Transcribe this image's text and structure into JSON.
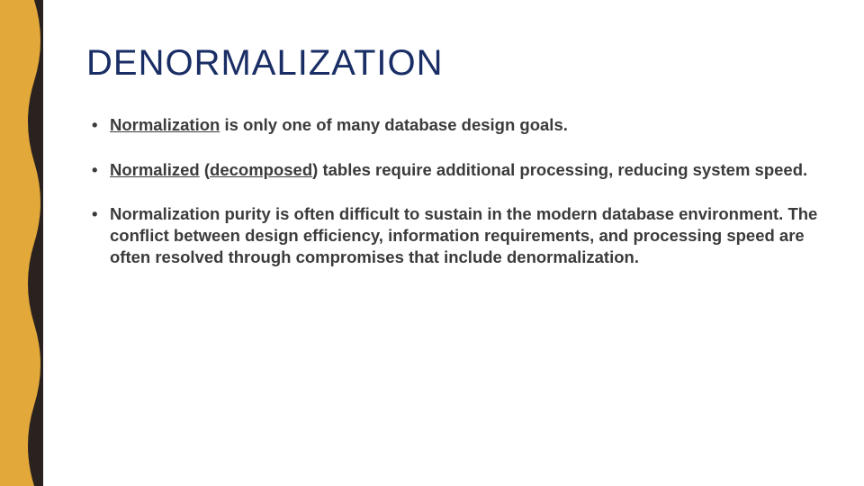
{
  "slide": {
    "title": "DENORMALIZATION",
    "bullets": [
      {
        "prefix_underlined": "Normalization",
        "rest": " is only one of many database design goals."
      },
      {
        "prefix_underlined": "Normalized",
        "mid_plain": " (",
        "mid_underlined": "decomposed",
        "rest": ") tables require additional processing, reducing system speed."
      },
      {
        "prefix_underlined": "",
        "rest": "Normalization purity is often difficult to sustain in the modern database environment. The conflict between design efficiency, information requirements, and processing speed are often resolved through compromises that include denormalization."
      }
    ],
    "colors": {
      "band_dark": "#2a221f",
      "band_gold": "#e2a83a",
      "title": "#1a2e66",
      "text": "#3b3b3b"
    }
  }
}
